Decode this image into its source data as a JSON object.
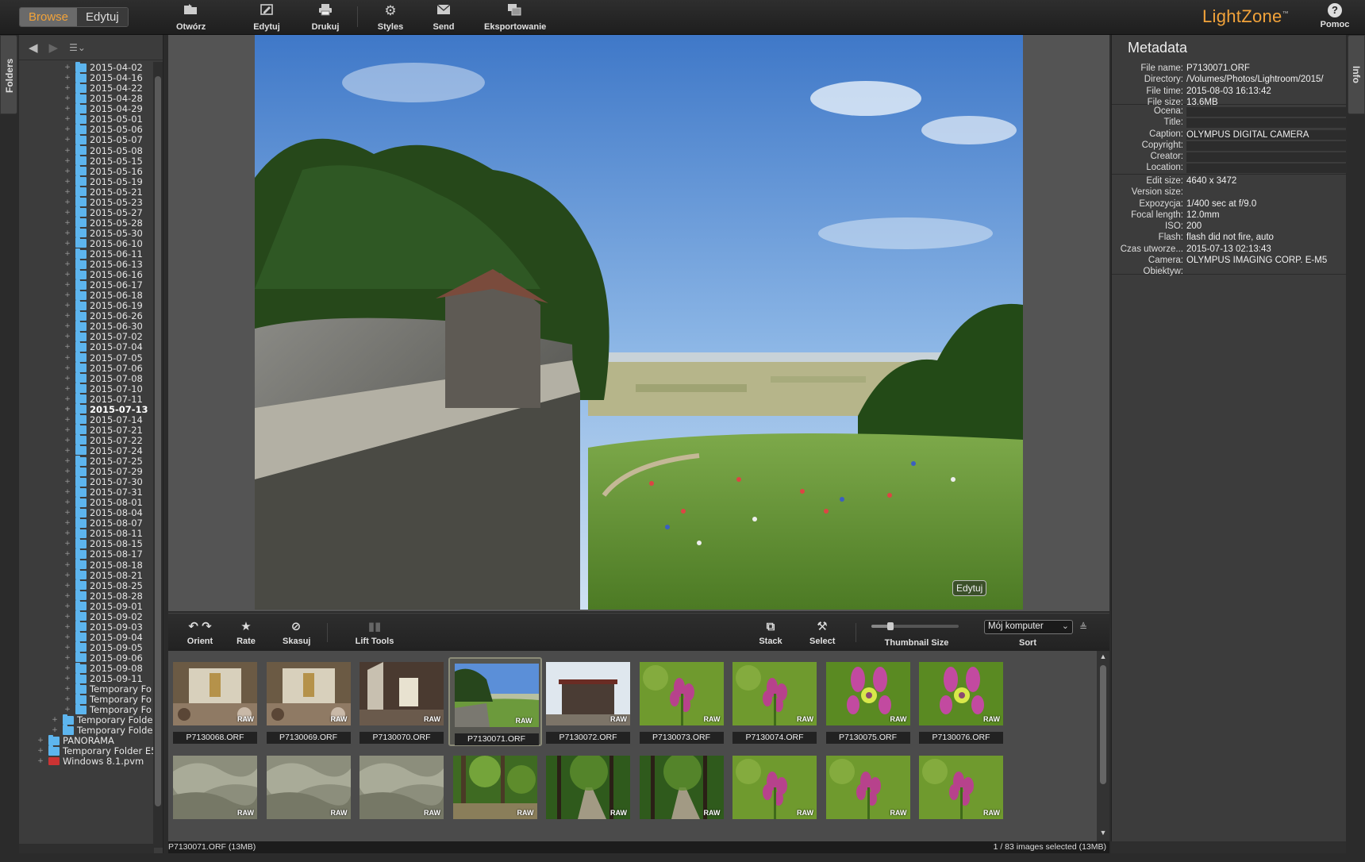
{
  "topbar": {
    "modes": [
      {
        "label": "Browse",
        "active": true
      },
      {
        "label": "Edytuj",
        "active": false
      }
    ],
    "buttons": [
      {
        "label": "Otwórz",
        "icon": "folder-open-icon"
      },
      {
        "label": "Edytuj",
        "icon": "edit-icon"
      },
      {
        "label": "Drukuj",
        "icon": "printer-icon"
      },
      {
        "label": "Styles",
        "icon": "gear-icon"
      },
      {
        "label": "Send",
        "icon": "envelope-icon"
      },
      {
        "label": "Eksportowanie",
        "icon": "export-icon"
      }
    ],
    "brand": "LightZone",
    "brand_tm": "™",
    "help_label": "Pomoc",
    "accent_color": "#f2a33a"
  },
  "tabs": {
    "folders": "Folders",
    "info": "Info"
  },
  "folders": {
    "items": [
      {
        "label": "2015-04-02",
        "level": 2
      },
      {
        "label": "2015-04-16",
        "level": 2
      },
      {
        "label": "2015-04-22",
        "level": 2
      },
      {
        "label": "2015-04-28",
        "level": 2
      },
      {
        "label": "2015-04-29",
        "level": 2
      },
      {
        "label": "2015-05-01",
        "level": 2
      },
      {
        "label": "2015-05-06",
        "level": 2
      },
      {
        "label": "2015-05-07",
        "level": 2
      },
      {
        "label": "2015-05-08",
        "level": 2
      },
      {
        "label": "2015-05-15",
        "level": 2
      },
      {
        "label": "2015-05-16",
        "level": 2
      },
      {
        "label": "2015-05-19",
        "level": 2
      },
      {
        "label": "2015-05-21",
        "level": 2
      },
      {
        "label": "2015-05-23",
        "level": 2
      },
      {
        "label": "2015-05-27",
        "level": 2
      },
      {
        "label": "2015-05-28",
        "level": 2
      },
      {
        "label": "2015-05-30",
        "level": 2
      },
      {
        "label": "2015-06-10",
        "level": 2
      },
      {
        "label": "2015-06-11",
        "level": 2
      },
      {
        "label": "2015-06-13",
        "level": 2
      },
      {
        "label": "2015-06-16",
        "level": 2
      },
      {
        "label": "2015-06-17",
        "level": 2
      },
      {
        "label": "2015-06-18",
        "level": 2
      },
      {
        "label": "2015-06-19",
        "level": 2
      },
      {
        "label": "2015-06-26",
        "level": 2
      },
      {
        "label": "2015-06-30",
        "level": 2
      },
      {
        "label": "2015-07-02",
        "level": 2
      },
      {
        "label": "2015-07-04",
        "level": 2
      },
      {
        "label": "2015-07-05",
        "level": 2
      },
      {
        "label": "2015-07-06",
        "level": 2
      },
      {
        "label": "2015-07-08",
        "level": 2
      },
      {
        "label": "2015-07-10",
        "level": 2
      },
      {
        "label": "2015-07-11",
        "level": 2
      },
      {
        "label": "2015-07-13",
        "level": 2,
        "selected": true
      },
      {
        "label": "2015-07-14",
        "level": 2
      },
      {
        "label": "2015-07-21",
        "level": 2
      },
      {
        "label": "2015-07-22",
        "level": 2
      },
      {
        "label": "2015-07-24",
        "level": 2
      },
      {
        "label": "2015-07-25",
        "level": 2
      },
      {
        "label": "2015-07-29",
        "level": 2
      },
      {
        "label": "2015-07-30",
        "level": 2
      },
      {
        "label": "2015-07-31",
        "level": 2
      },
      {
        "label": "2015-08-01",
        "level": 2
      },
      {
        "label": "2015-08-04",
        "level": 2
      },
      {
        "label": "2015-08-07",
        "level": 2
      },
      {
        "label": "2015-08-11",
        "level": 2
      },
      {
        "label": "2015-08-15",
        "level": 2
      },
      {
        "label": "2015-08-17",
        "level": 2
      },
      {
        "label": "2015-08-18",
        "level": 2
      },
      {
        "label": "2015-08-21",
        "level": 2
      },
      {
        "label": "2015-08-25",
        "level": 2
      },
      {
        "label": "2015-08-28",
        "level": 2
      },
      {
        "label": "2015-09-01",
        "level": 2
      },
      {
        "label": "2015-09-02",
        "level": 2
      },
      {
        "label": "2015-09-03",
        "level": 2
      },
      {
        "label": "2015-09-04",
        "level": 2
      },
      {
        "label": "2015-09-05",
        "level": 2
      },
      {
        "label": "2015-09-06",
        "level": 2
      },
      {
        "label": "2015-09-08",
        "level": 2
      },
      {
        "label": "2015-09-11",
        "level": 2
      },
      {
        "label": "Temporary Fo",
        "level": 2
      },
      {
        "label": "Temporary Fo",
        "level": 2
      },
      {
        "label": "Temporary Fo",
        "level": 2
      },
      {
        "label": "Temporary Folde",
        "level": 1
      },
      {
        "label": "Temporary Folde",
        "level": 1
      },
      {
        "label": "PANORAMA",
        "level": 0
      },
      {
        "label": "Temporary Folder E5",
        "level": 0
      },
      {
        "label": "Windows 8.1.pvm",
        "level": 0,
        "type": "vm"
      }
    ]
  },
  "viewer": {
    "edit_overlay": "Edytuj"
  },
  "browsebar": {
    "buttons": [
      {
        "label": "Orient",
        "icon": "rotate-icon"
      },
      {
        "label": "Rate",
        "icon": "star-icon"
      },
      {
        "label": "Skasuj",
        "icon": "delete-icon"
      },
      {
        "label": "Lift Tools",
        "icon": "copy-tools-icon"
      },
      {
        "label": "Stack",
        "icon": "stack-icon"
      },
      {
        "label": "Select",
        "icon": "select-icon"
      }
    ],
    "thumbnail_size_label": "Thumbnail Size",
    "thumbnail_size_level": 0.22,
    "sort_value": "Mój komputer",
    "sort_label": "Sort"
  },
  "grid": {
    "badge": "RAW",
    "row1": [
      {
        "name": "P7130068.ORF",
        "scene": "church-interior"
      },
      {
        "name": "P7130069.ORF",
        "scene": "church-interior"
      },
      {
        "name": "P7130070.ORF",
        "scene": "stone-interior"
      },
      {
        "name": "P7130071.ORF",
        "scene": "landscape",
        "selected": true
      },
      {
        "name": "P7130072.ORF",
        "scene": "tower"
      },
      {
        "name": "P7130073.ORF",
        "scene": "flower"
      },
      {
        "name": "P7130074.ORF",
        "scene": "flower"
      },
      {
        "name": "P7130075.ORF",
        "scene": "flower-close"
      },
      {
        "name": "P7130076.ORF",
        "scene": "flower-close"
      }
    ],
    "row2": [
      {
        "scene": "rock"
      },
      {
        "scene": "rock"
      },
      {
        "scene": "rock"
      },
      {
        "scene": "forest"
      },
      {
        "scene": "forest-path"
      },
      {
        "scene": "forest-path"
      },
      {
        "scene": "flower"
      },
      {
        "scene": "flower"
      },
      {
        "scene": "flower"
      }
    ]
  },
  "status": {
    "left": "P7130071.ORF (13MB)",
    "right": "1 / 83 images selected (13MB)"
  },
  "metadata": {
    "title": "Metadata",
    "groups": [
      [
        {
          "label": "File name:",
          "value": "P7130071.ORF"
        },
        {
          "label": "Directory:",
          "value": "/Volumes/Photos/Lightroom/2015/"
        },
        {
          "label": "File time:",
          "value": "2015-08-03 16:13:42"
        },
        {
          "label": "File size:",
          "value": "13.6MB"
        }
      ],
      [
        {
          "label": "Ocena:",
          "value": "",
          "field": true
        },
        {
          "label": "Title:",
          "value": "",
          "field": true
        },
        {
          "label": "Caption:",
          "value": "OLYMPUS DIGITAL CAMERA",
          "field": true
        },
        {
          "label": "Copyright:",
          "value": "",
          "field": true
        },
        {
          "label": "Creator:",
          "value": "",
          "field": true
        },
        {
          "label": "Location:",
          "value": "",
          "field": true
        }
      ],
      [
        {
          "label": "Edit size:",
          "value": "4640 x 3472"
        },
        {
          "label": "Version size:",
          "value": ""
        },
        {
          "label": "Expozycja:",
          "value": "1/400 sec at f/9.0"
        },
        {
          "label": "Focal length:",
          "value": "12.0mm"
        },
        {
          "label": "ISO:",
          "value": "200"
        },
        {
          "label": "Flash:",
          "value": "flash did not fire, auto"
        },
        {
          "label": "Czas utworze...",
          "value": "2015-07-13 02:13:43"
        },
        {
          "label": "Camera:",
          "value": "OLYMPUS IMAGING CORP. E-M5"
        },
        {
          "label": "Obiektyw:",
          "value": ""
        }
      ]
    ]
  }
}
